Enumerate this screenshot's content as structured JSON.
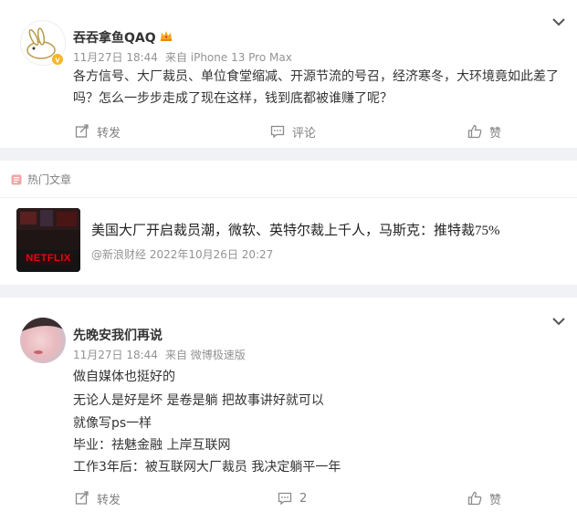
{
  "post": {
    "username": "吞吞拿鱼QAQ",
    "date": "11月27日 18:44",
    "source": "来自 iPhone 13 Pro Max",
    "content": "各方信号、大厂裁员、单位食堂缩减、开源节流的号召，经济寒冬，大环境竟如此差了吗？怎么一步步走成了现在这样，钱到底都被谁赚了呢？",
    "actions": {
      "repost": "转发",
      "comment": "评论",
      "like": "赞"
    }
  },
  "hot_article": {
    "header": "热门文章",
    "thumbnail_text": "NETFLIX",
    "title": "美国大厂开启裁员潮，微软、英特尔裁上千人，马斯克：推特裁75%",
    "meta": "@新浪财经 2022年10月26日 20:27"
  },
  "comment": {
    "username": "先晚安我们再说",
    "date": "11月27日 18:44",
    "source": "来自 微博极速版",
    "lines": [
      "做自媒体也挺好的",
      "无论人是好是坏 是卷是躺 把故事讲好就可以",
      "就像写ps一样",
      "毕业：祛魅金融 上岸互联网",
      "工作3年后：被互联网大厂裁员 我决定躺平一年"
    ],
    "actions": {
      "repost": "转发",
      "comment": "2",
      "like": "赞"
    }
  },
  "colors": {
    "accent": "#ff8200",
    "badge": "#f6b52a",
    "text": "#333333",
    "muted": "#939393"
  }
}
